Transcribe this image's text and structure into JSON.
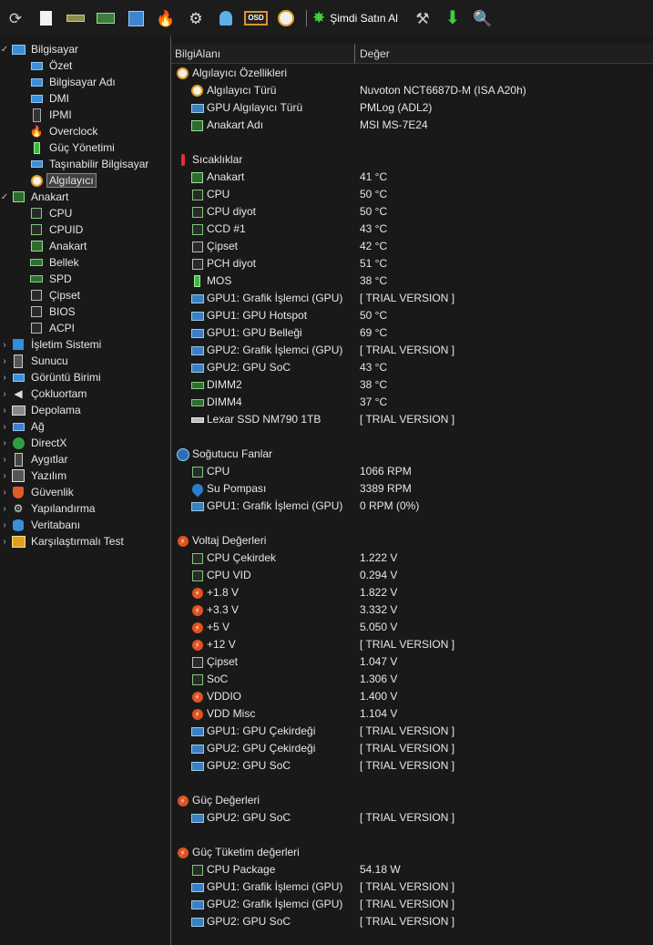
{
  "toolbar": {
    "buy_label": "Şimdi Satın Al",
    "osd_label": "OSD"
  },
  "tree": [
    {
      "label": "Bilgisayar",
      "level": 0,
      "chev": "expanded",
      "icon": "computer-icon"
    },
    {
      "label": "Özet",
      "level": 1,
      "icon": "monitor-icon"
    },
    {
      "label": "Bilgisayar Adı",
      "level": 1,
      "icon": "monitor-icon"
    },
    {
      "label": "DMI",
      "level": 1,
      "icon": "monitor-icon"
    },
    {
      "label": "IPMI",
      "level": 1,
      "icon": "phone-icon"
    },
    {
      "label": "Overclock",
      "level": 1,
      "icon": "flame-icon"
    },
    {
      "label": "Güç Yönetimi",
      "level": 1,
      "icon": "battery-icon"
    },
    {
      "label": "Taşınabilir Bilgisayar",
      "level": 1,
      "icon": "laptop-icon"
    },
    {
      "label": "Algılayıcı",
      "level": 1,
      "icon": "gauge-icon",
      "selected": true
    },
    {
      "label": "Anakart",
      "level": 0,
      "chev": "expanded",
      "icon": "motherboard-icon"
    },
    {
      "label": "CPU",
      "level": 1,
      "icon": "chip-icon"
    },
    {
      "label": "CPUID",
      "level": 1,
      "icon": "chip-icon"
    },
    {
      "label": "Anakart",
      "level": 1,
      "icon": "motherboard-icon"
    },
    {
      "label": "Bellek",
      "level": 1,
      "icon": "ram-icon"
    },
    {
      "label": "SPD",
      "level": 1,
      "icon": "ram-icon"
    },
    {
      "label": "Çipset",
      "level": 1,
      "icon": "chipset-icon"
    },
    {
      "label": "BIOS",
      "level": 1,
      "icon": "chipset-icon"
    },
    {
      "label": "ACPI",
      "level": 1,
      "icon": "chipset-icon"
    },
    {
      "label": "İşletim Sistemi",
      "level": 0,
      "chev": "collapsed",
      "icon": "windows-icon"
    },
    {
      "label": "Sunucu",
      "level": 0,
      "chev": "collapsed",
      "icon": "server-icon"
    },
    {
      "label": "Görüntü Birimi",
      "level": 0,
      "chev": "collapsed",
      "icon": "display-icon"
    },
    {
      "label": "Çokluortam",
      "level": 0,
      "chev": "collapsed",
      "icon": "speaker-icon"
    },
    {
      "label": "Depolama",
      "level": 0,
      "chev": "collapsed",
      "icon": "storage-icon"
    },
    {
      "label": "Ağ",
      "level": 0,
      "chev": "collapsed",
      "icon": "network-icon"
    },
    {
      "label": "DirectX",
      "level": 0,
      "chev": "collapsed",
      "icon": "xbox-icon"
    },
    {
      "label": "Aygıtlar",
      "level": 0,
      "chev": "collapsed",
      "icon": "device-icon"
    },
    {
      "label": "Yazılım",
      "level": 0,
      "chev": "collapsed",
      "icon": "software-icon"
    },
    {
      "label": "Güvenlik",
      "level": 0,
      "chev": "collapsed",
      "icon": "shield-icon"
    },
    {
      "label": "Yapılandırma",
      "level": 0,
      "chev": "collapsed",
      "icon": "gear-icon"
    },
    {
      "label": "Veritabanı",
      "level": 0,
      "chev": "collapsed",
      "icon": "database-icon"
    },
    {
      "label": "Karşılaştırmalı Test",
      "level": 0,
      "chev": "collapsed",
      "icon": "benchmark-icon"
    }
  ],
  "columns": {
    "field": "BilgiAlanı",
    "value": "Değer"
  },
  "rows": [
    {
      "type": "section",
      "name": "Algılayıcı Özellikleri",
      "icon": "gauge-icon"
    },
    {
      "type": "item",
      "name": "Algılayıcı Türü",
      "value": "Nuvoton NCT6687D-M  (ISA A20h)",
      "icon": "gauge-icon"
    },
    {
      "type": "item",
      "name": "GPU Algılayıcı Türü",
      "value": "PMLog  (ADL2)",
      "icon": "gpu-icon"
    },
    {
      "type": "item",
      "name": "Anakart Adı",
      "value": "MSI MS-7E24",
      "icon": "motherboard-icon"
    },
    {
      "type": "blank"
    },
    {
      "type": "section",
      "name": "Sıcaklıklar",
      "icon": "thermometer-icon"
    },
    {
      "type": "item",
      "name": "Anakart",
      "value": "41 °C",
      "icon": "motherboard-icon"
    },
    {
      "type": "item",
      "name": "CPU",
      "value": "50 °C",
      "icon": "chip-icon"
    },
    {
      "type": "item",
      "name": "CPU diyot",
      "value": "50 °C",
      "icon": "chip-icon"
    },
    {
      "type": "item",
      "name": "CCD #1",
      "value": "43 °C",
      "icon": "chip-icon"
    },
    {
      "type": "item",
      "name": "Çipset",
      "value": "42 °C",
      "icon": "chipset-icon"
    },
    {
      "type": "item",
      "name": "PCH diyot",
      "value": "51 °C",
      "icon": "chipset-icon"
    },
    {
      "type": "item",
      "name": "MOS",
      "value": "38 °C",
      "icon": "battery-icon"
    },
    {
      "type": "item",
      "name": "GPU1: Grafik İşlemci (GPU)",
      "value": "[ TRIAL VERSION ]",
      "icon": "gpu-icon"
    },
    {
      "type": "item",
      "name": "GPU1: GPU Hotspot",
      "value": "50 °C",
      "icon": "gpu-icon"
    },
    {
      "type": "item",
      "name": "GPU1: GPU Belleği",
      "value": "69 °C",
      "icon": "gpu-icon"
    },
    {
      "type": "item",
      "name": "GPU2: Grafik İşlemci (GPU)",
      "value": "[ TRIAL VERSION ]",
      "icon": "gpu-icon"
    },
    {
      "type": "item",
      "name": "GPU2: GPU SoC",
      "value": "43 °C",
      "icon": "gpu-icon"
    },
    {
      "type": "item",
      "name": "DIMM2",
      "value": "38 °C",
      "icon": "ram-icon"
    },
    {
      "type": "item",
      "name": "DIMM4",
      "value": "37 °C",
      "icon": "ram-icon"
    },
    {
      "type": "item",
      "name": "Lexar SSD NM790 1TB",
      "value": "[ TRIAL VERSION ]",
      "icon": "ssd-icon"
    },
    {
      "type": "blank"
    },
    {
      "type": "section",
      "name": "Soğutucu Fanlar",
      "icon": "fan-icon"
    },
    {
      "type": "item",
      "name": "CPU",
      "value": "1066 RPM",
      "icon": "chip-icon"
    },
    {
      "type": "item",
      "name": "Su Pompası",
      "value": "3389 RPM",
      "icon": "water-drop-icon"
    },
    {
      "type": "item",
      "name": "GPU1: Grafik İşlemci (GPU)",
      "value": "0 RPM  (0%)",
      "icon": "gpu-icon"
    },
    {
      "type": "blank"
    },
    {
      "type": "section",
      "name": "Voltaj Değerleri",
      "icon": "voltage-icon"
    },
    {
      "type": "item",
      "name": "CPU Çekirdek",
      "value": "1.222 V",
      "icon": "chip-icon"
    },
    {
      "type": "item",
      "name": "CPU VID",
      "value": "0.294 V",
      "icon": "chip-icon"
    },
    {
      "type": "item",
      "name": "+1.8 V",
      "value": "1.822 V",
      "icon": "voltage-icon"
    },
    {
      "type": "item",
      "name": "+3.3 V",
      "value": "3.332 V",
      "icon": "voltage-icon"
    },
    {
      "type": "item",
      "name": "+5 V",
      "value": "5.050 V",
      "icon": "voltage-icon"
    },
    {
      "type": "item",
      "name": "+12 V",
      "value": "[ TRIAL VERSION ]",
      "icon": "voltage-icon"
    },
    {
      "type": "item",
      "name": "Çipset",
      "value": "1.047 V",
      "icon": "chipset-icon"
    },
    {
      "type": "item",
      "name": "SoC",
      "value": "1.306 V",
      "icon": "chip-icon"
    },
    {
      "type": "item",
      "name": "VDDIO",
      "value": "1.400 V",
      "icon": "voltage-icon"
    },
    {
      "type": "item",
      "name": "VDD Misc",
      "value": "1.104 V",
      "icon": "voltage-icon"
    },
    {
      "type": "item",
      "name": "GPU1: GPU Çekirdeği",
      "value": "[ TRIAL VERSION ]",
      "icon": "gpu-icon"
    },
    {
      "type": "item",
      "name": "GPU2: GPU Çekirdeği",
      "value": "[ TRIAL VERSION ]",
      "icon": "gpu-icon"
    },
    {
      "type": "item",
      "name": "GPU2: GPU SoC",
      "value": "[ TRIAL VERSION ]",
      "icon": "gpu-icon"
    },
    {
      "type": "blank"
    },
    {
      "type": "section",
      "name": "Güç Değerleri",
      "icon": "voltage-icon"
    },
    {
      "type": "item",
      "name": "GPU2: GPU SoC",
      "value": "[ TRIAL VERSION ]",
      "icon": "gpu-icon"
    },
    {
      "type": "blank"
    },
    {
      "type": "section",
      "name": "Güç Tüketim değerleri",
      "icon": "voltage-icon"
    },
    {
      "type": "item",
      "name": "CPU Package",
      "value": "54.18 W",
      "icon": "chip-icon"
    },
    {
      "type": "item",
      "name": "GPU1: Grafik İşlemci (GPU)",
      "value": "[ TRIAL VERSION ]",
      "icon": "gpu-icon"
    },
    {
      "type": "item",
      "name": "GPU2: Grafik İşlemci (GPU)",
      "value": "[ TRIAL VERSION ]",
      "icon": "gpu-icon"
    },
    {
      "type": "item",
      "name": "GPU2: GPU SoC",
      "value": "[ TRIAL VERSION ]",
      "icon": "gpu-icon"
    }
  ]
}
